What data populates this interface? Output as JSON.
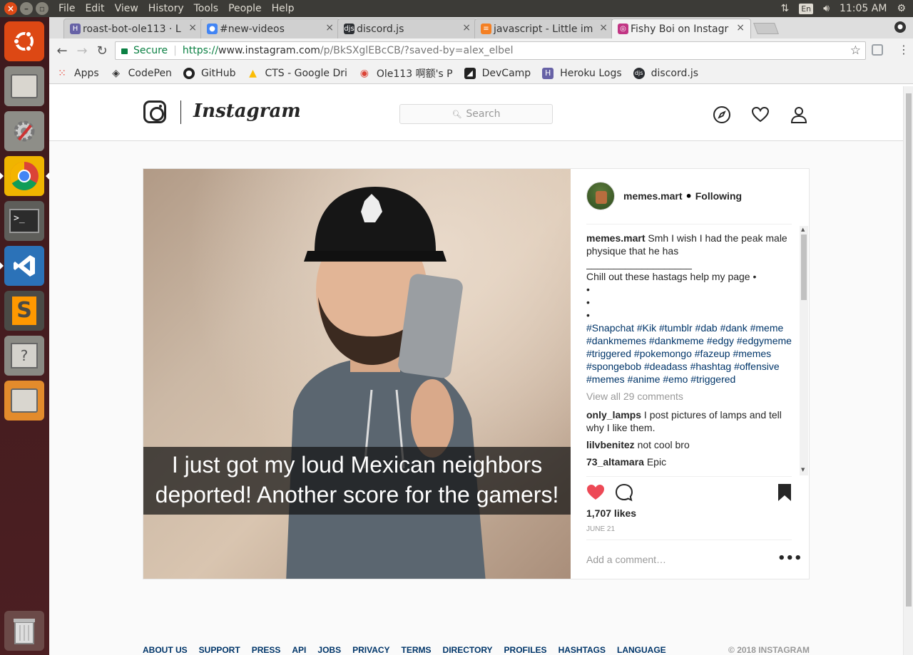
{
  "os_menu": {
    "items": [
      "File",
      "Edit",
      "View",
      "History",
      "Tools",
      "People",
      "Help"
    ],
    "keyboard": "En",
    "time": "11:05 AM"
  },
  "tabs": [
    {
      "title": "roast-bot-ole113 · L",
      "icon": "heroku-icon",
      "color": "#6762a6"
    },
    {
      "title": "#new-videos",
      "icon": "discord-alert-icon",
      "color": "#4285f4"
    },
    {
      "title": "discord.js",
      "icon": "discordjs-icon",
      "color": "#2c2f33"
    },
    {
      "title": "javascript - Little im",
      "icon": "stackoverflow-icon",
      "color": "#f48024"
    },
    {
      "title": "Fishy Boi on Instagr",
      "icon": "instagram-icon",
      "color": "#c13584"
    }
  ],
  "omnibox": {
    "secure_label": "Secure",
    "scheme": "https://",
    "host": "www.instagram.com",
    "path": "/p/BkSXglEBcCB/?saved-by=alex_elbel"
  },
  "bookmarks": [
    {
      "label": "Apps",
      "icon": "apps-grid-icon"
    },
    {
      "label": "CodePen",
      "icon": "codepen-icon"
    },
    {
      "label": "GitHub",
      "icon": "github-icon"
    },
    {
      "label": "CTS - Google Dri",
      "icon": "drive-icon"
    },
    {
      "label": "Ole113 啊额's P",
      "icon": "chrome-webstore-icon"
    },
    {
      "label": "DevCamp",
      "icon": "devcamp-icon"
    },
    {
      "label": "Heroku Logs",
      "icon": "heroku-icon"
    },
    {
      "label": "discord.js",
      "icon": "discordjs-icon"
    }
  ],
  "instagram": {
    "wordmark": "Instagram",
    "search_placeholder": "Search",
    "post": {
      "image_caption_line1": "I just got my loud Mexican neighbors",
      "image_caption_line2": "deported! Another score for the gamers!",
      "owner": "memes.mart",
      "separator": "•",
      "follow_status": "Following",
      "caption_user": "memes.mart",
      "caption_text": "Smh I wish I had the peak male physique that he has",
      "caption_underline": "___________________",
      "caption_line2": "Chill out these hastags help my page •",
      "bullets": [
        "•",
        "•",
        "•"
      ],
      "hashtags": "#Snapchat #Kik #tumblr #dab #dank #meme #dankmemes #dankmeme #edgy #edgymeme #triggered #pokemongo #fazeup #memes #spongebob #deadass #hashtag #offensive #memes #anime #emo #triggered",
      "view_all": "View all 29 comments",
      "comments": [
        {
          "user": "only_lamps",
          "text": "I post pictures of lamps and tell why I like them."
        },
        {
          "user": "lilvbenitez",
          "text": "not cool bro"
        },
        {
          "user": "73_altamara",
          "text": "Epic"
        }
      ],
      "likes": "1,707 likes",
      "date": "JUNE 21",
      "add_comment_placeholder": "Add a comment…",
      "more": "•••",
      "like_color": "#ed4956"
    },
    "footer": {
      "links": [
        "ABOUT US",
        "SUPPORT",
        "PRESS",
        "API",
        "JOBS",
        "PRIVACY",
        "TERMS",
        "DIRECTORY",
        "PROFILES",
        "HASHTAGS",
        "LANGUAGE"
      ],
      "copyright": "© 2018 INSTAGRAM"
    }
  }
}
